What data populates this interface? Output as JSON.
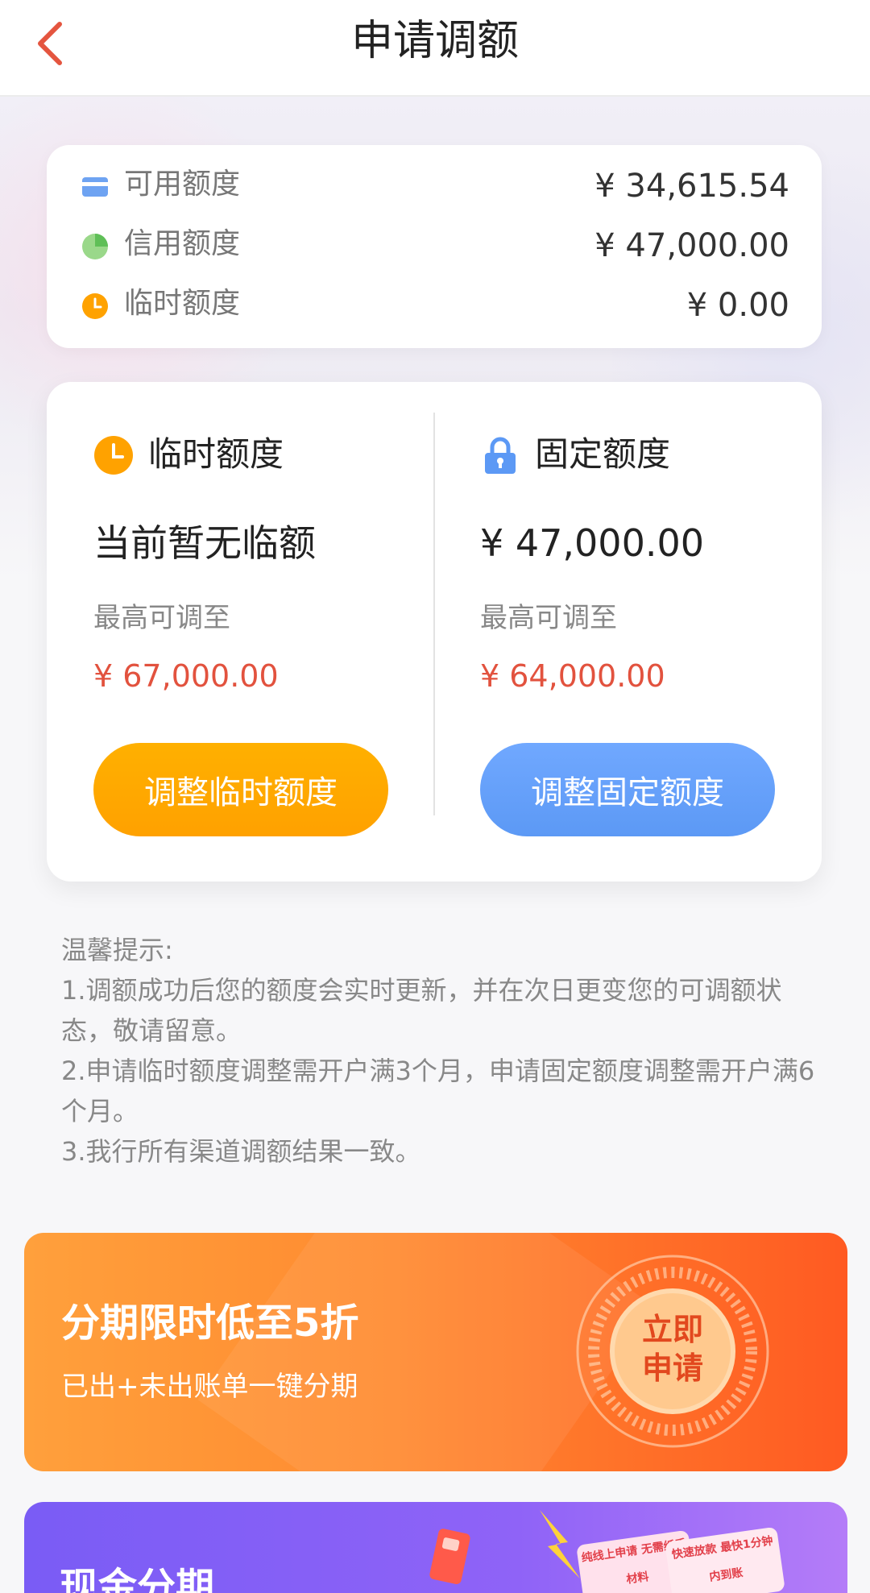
{
  "header": {
    "title": "申请调额"
  },
  "summary": {
    "rows": [
      {
        "label": "可用额度",
        "value": "¥ 34,615.54",
        "icon": "card-icon"
      },
      {
        "label": "信用额度",
        "value": "¥ 47,000.00",
        "icon": "pie-chart-icon"
      },
      {
        "label": "临时额度",
        "value": "¥ 0.00",
        "icon": "clock-icon"
      }
    ]
  },
  "quota": {
    "temporary": {
      "title": "临时额度",
      "current": "当前暂无临额",
      "max_label": "最高可调至",
      "max_value": "¥ 67,000.00",
      "button": "调整临时额度"
    },
    "fixed": {
      "title": "固定额度",
      "current": "¥ 47,000.00",
      "max_label": "最高可调至",
      "max_value": "¥ 64,000.00",
      "button": "调整固定额度"
    }
  },
  "tips": {
    "title": "温馨提示:",
    "lines": [
      "1.调额成功后您的额度会实时更新，并在次日更变您的可调额状态，敬请留意。",
      "2.申请临时额度调整需开户满3个月，申请固定额度调整需开户满6个月。",
      "3.我行所有渠道调额结果一致。"
    ]
  },
  "promo": {
    "title": "分期限时低至5折",
    "subtitle": "已出+未出账单一键分期",
    "button": "立即申请"
  },
  "cash": {
    "title": "现金分期",
    "tag1": "纯线上申请 无需纸质材料",
    "tag2": "快速放款 最快1分钟内到账"
  },
  "colors": {
    "accent_orange": "#ffa100",
    "accent_blue": "#5c99f5",
    "price_red": "#e2523e",
    "back_arrow": "#e4553f"
  }
}
